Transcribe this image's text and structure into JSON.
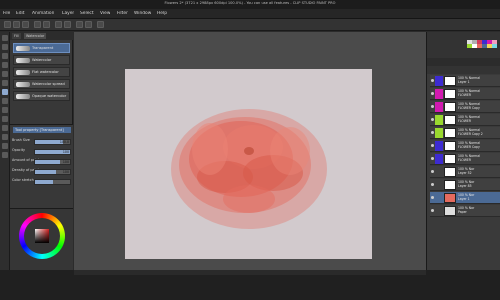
{
  "window": {
    "title": "Flowers 2* (3721 x 2988px 600dpi 100.0%) - You can use all features - CLIP STUDIO PAINT PRO"
  },
  "menu": [
    "File",
    "Edit",
    "Animation",
    "Layer",
    "Select",
    "View",
    "Filter",
    "Window",
    "Help"
  ],
  "subtool": {
    "tabs": [
      "Fill",
      "Watercolor"
    ],
    "brushes": [
      {
        "label": "Transparent",
        "selected": true
      },
      {
        "label": "Watercolor",
        "selected": false
      },
      {
        "label": "Flat watercolor",
        "selected": false
      },
      {
        "label": "Watercolor spread",
        "selected": false
      },
      {
        "label": "Opaque watercolor",
        "selected": false
      }
    ]
  },
  "tool_property": {
    "title": "Tool property [Transparent]",
    "rows": [
      {
        "label": "Brush Size",
        "value": "100.0",
        "level": 0.8
      },
      {
        "label": "Opacity",
        "value": "100",
        "level": 1.0
      },
      {
        "label": "Amount of paint",
        "value": "100",
        "level": 0.7
      },
      {
        "label": "Density of paint",
        "value": "100",
        "level": 0.6
      },
      {
        "label": "Color stretch",
        "value": "",
        "level": 0.5
      }
    ]
  },
  "layers": [
    {
      "title": "100 % Normal",
      "name": "Layer 1",
      "chip": "#3d2bd1",
      "thumb": "#ffffff"
    },
    {
      "title": "100 % Normal",
      "name": "FLOWER",
      "chip": "#d21ab0",
      "thumb": "#ffffff"
    },
    {
      "title": "100 % Normal",
      "name": "FLOWER Copy",
      "chip": "#d21ab0",
      "thumb": "#ffffff"
    },
    {
      "title": "100 % Normal",
      "name": "FLOWER",
      "chip": "#9ad92f",
      "thumb": "#ffffff"
    },
    {
      "title": "100 % Normal",
      "name": "FLOWER Copy 2",
      "chip": "#9ad92f",
      "thumb": "#ffffff"
    },
    {
      "title": "100 % Normal",
      "name": "FLOWER Copy",
      "chip": "#3d2bd1",
      "thumb": "#ffffff"
    },
    {
      "title": "100 % Normal",
      "name": "FLOWER",
      "chip": "#3d2bd1",
      "thumb": "#ffffff"
    },
    {
      "title": "100 % Nor",
      "name": "Layer 52",
      "chip": "",
      "thumb": "#ffffff"
    },
    {
      "title": "100 % Nor",
      "name": "Layer 85",
      "chip": "",
      "thumb": "#ffffff"
    },
    {
      "title": "100 % Nor",
      "name": "Layer 1",
      "chip": "",
      "thumb": "#e46a5e"
    },
    {
      "title": "100 % Nor",
      "name": "Paper",
      "chip": "",
      "thumb": "#dddddd"
    }
  ],
  "colors": {
    "accent": "#4b6a95",
    "flower": "#e46a5e",
    "canvas": "#d2cacd"
  }
}
